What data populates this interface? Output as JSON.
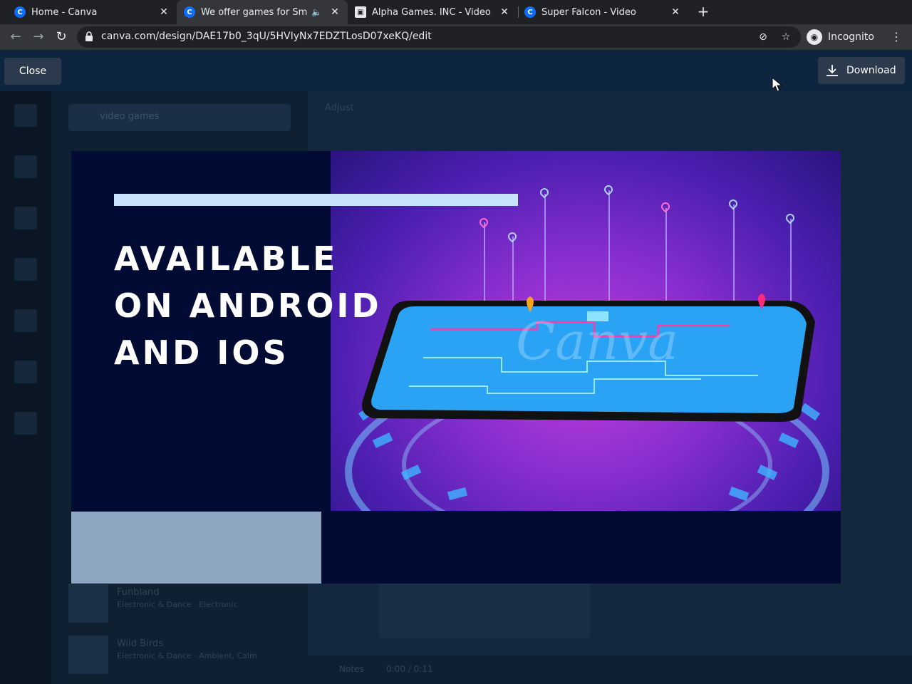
{
  "browser": {
    "tabs": [
      {
        "title": "Home - Canva",
        "icon": "canva-icon"
      },
      {
        "title": "We offer games for Sm",
        "icon": "canva-icon",
        "audio": true
      },
      {
        "title": "Alpha Games. INC - Video",
        "icon": "document-icon"
      },
      {
        "title": "Super Falcon - Video",
        "icon": "canva-icon"
      }
    ],
    "new_tab_label": "+",
    "url": "canva.com/design/DAE17b0_3qU/5HVIyNx7EDZTLosD07xeKQ/edit",
    "profile_label": "Incognito"
  },
  "header": {
    "close_label": "Close",
    "download_label": "Download"
  },
  "editor": {
    "search_placeholder": "video games",
    "adjust_label": "Adjust",
    "notes_label": "Notes",
    "time_label": "0:00 / 0:11",
    "list_items": [
      {
        "title": "Funbland",
        "subtitle": "Electronic & Dance · Electronic"
      },
      {
        "title": "Wild Birds",
        "subtitle": "Electronic & Dance · Ambient, Calm"
      }
    ]
  },
  "preview": {
    "headline_lines": [
      "AVAILABLE",
      "ON ANDROID",
      "AND IOS"
    ],
    "watermark": "Canva",
    "colors": {
      "background": "#020b33",
      "top_bar": "#c7e3fb",
      "bottom_block": "#8fa6c3",
      "headline": "#ffffff"
    }
  }
}
